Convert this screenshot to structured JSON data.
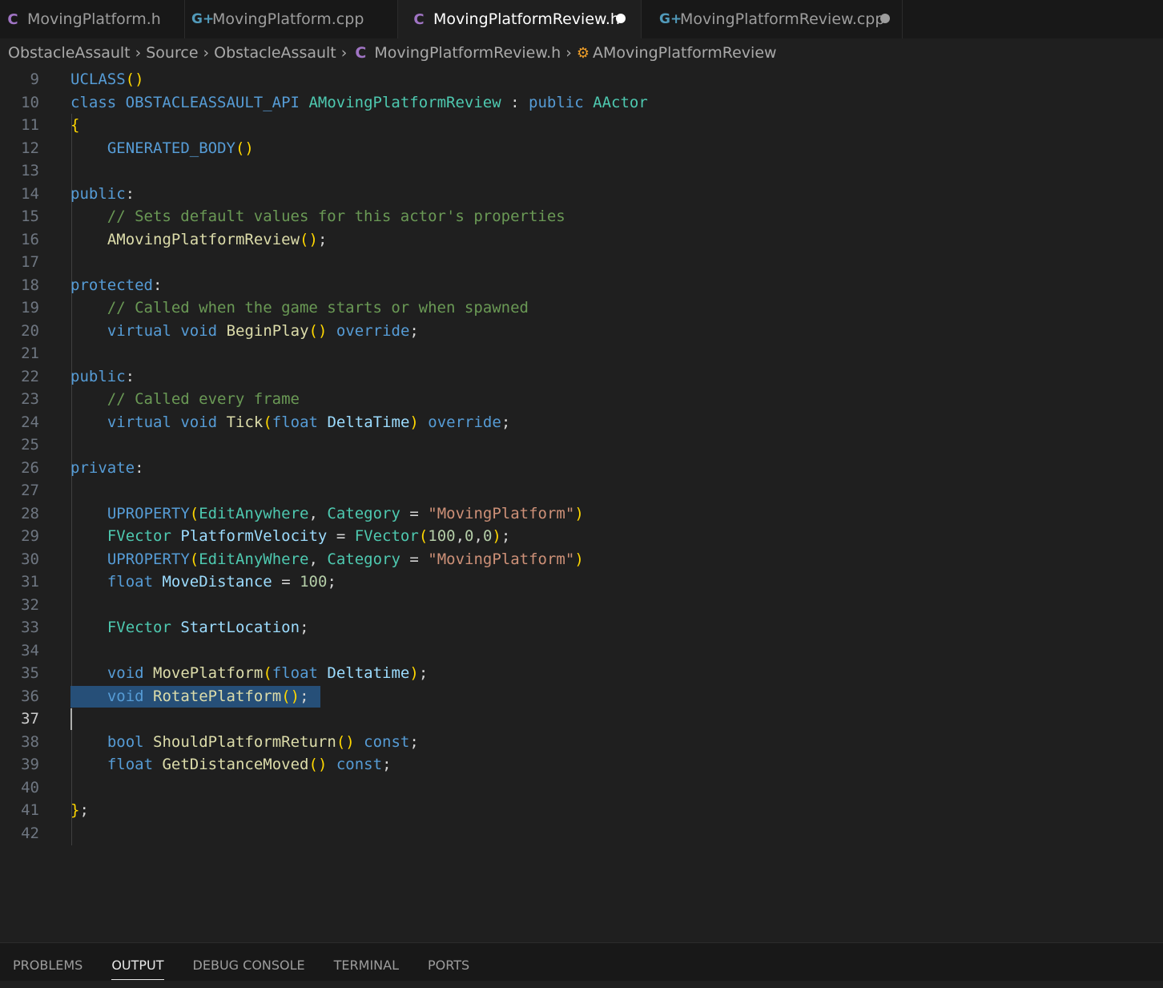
{
  "tabs": [
    {
      "label": "MovingPlatform.h",
      "icon": "C",
      "icon_name": "c-header-file-icon",
      "active": false,
      "dirty": false
    },
    {
      "label": "MovingPlatform.cpp",
      "icon": "G+",
      "icon_name": "cpp-file-icon",
      "active": false,
      "dirty": false
    },
    {
      "label": "MovingPlatformReview.h",
      "icon": "C",
      "icon_name": "c-header-file-icon",
      "active": true,
      "dirty": true
    },
    {
      "label": "MovingPlatformReview.cpp",
      "icon": "G+",
      "icon_name": "cpp-file-icon",
      "active": false,
      "dirty": true
    }
  ],
  "breadcrumb": {
    "parts": [
      "ObstacleAssault",
      "Source",
      "ObstacleAssault"
    ],
    "file": "MovingPlatformReview.h",
    "file_icon": "C",
    "symbol": "AMovingPlatformReview",
    "symbol_icon": "class-symbol-icon"
  },
  "editor": {
    "line_numbers": [
      "9",
      "10",
      "11",
      "12",
      "13",
      "14",
      "15",
      "16",
      "17",
      "18",
      "19",
      "20",
      "21",
      "22",
      "23",
      "24",
      "25",
      "26",
      "27",
      "28",
      "29",
      "30",
      "31",
      "32",
      "33",
      "34",
      "35",
      "36",
      "37",
      "38",
      "39",
      "40",
      "41",
      "42"
    ],
    "current_line": "37",
    "selected_line": "36",
    "lines": [
      "UCLASS()",
      "class OBSTACLEASSAULT_API AMovingPlatformReview : public AActor",
      "{",
      "    GENERATED_BODY()",
      "",
      "public:",
      "    // Sets default values for this actor's properties",
      "    AMovingPlatformReview();",
      "",
      "protected:",
      "    // Called when the game starts or when spawned",
      "    virtual void BeginPlay() override;",
      "",
      "public:",
      "    // Called every frame",
      "    virtual void Tick(float DeltaTime) override;",
      "",
      "private:",
      "",
      "    UPROPERTY(EditAnywhere, Category = \"MovingPlatform\")",
      "    FVector PlatformVelocity = FVector(100,0,0);",
      "    UPROPERTY(EditAnyWhere, Category = \"MovingPlatform\")",
      "    float MoveDistance = 100;",
      "",
      "    FVector StartLocation;",
      "",
      "    void MovePlatform(float Deltatime);",
      "    void RotatePlatform();",
      "",
      "    bool ShouldPlatformReturn() const;",
      "    float GetDistanceMoved() const;",
      "",
      "};",
      ""
    ]
  },
  "panel": {
    "tabs": [
      "PROBLEMS",
      "OUTPUT",
      "DEBUG CONSOLE",
      "TERMINAL",
      "PORTS"
    ],
    "active": "OUTPUT"
  },
  "colors": {
    "editor_bg": "#1f1f1f",
    "tabbar_bg": "#181818",
    "selection": "#264f78",
    "c_icon": "#a074c4",
    "cpp_icon": "#519aba",
    "symbol_icon": "#ee9d28"
  }
}
